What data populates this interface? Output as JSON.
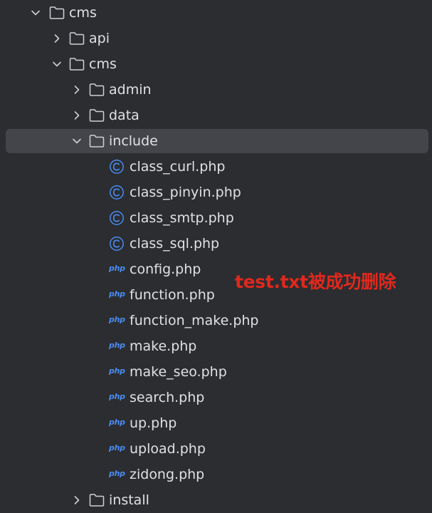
{
  "tree": {
    "items": [
      {
        "label": "cms",
        "icon": "folder-icon",
        "expanded": true
      },
      {
        "label": "api",
        "icon": "folder-icon",
        "expanded": false
      },
      {
        "label": "cms",
        "icon": "folder-icon",
        "expanded": true
      },
      {
        "label": "admin",
        "icon": "folder-icon",
        "expanded": false
      },
      {
        "label": "data",
        "icon": "folder-icon",
        "expanded": false
      },
      {
        "label": "include",
        "icon": "folder-icon",
        "expanded": true,
        "selected": true
      },
      {
        "label": "class_curl.php",
        "icon": "class-icon"
      },
      {
        "label": "class_pinyin.php",
        "icon": "class-icon"
      },
      {
        "label": "class_smtp.php",
        "icon": "class-icon"
      },
      {
        "label": "class_sql.php",
        "icon": "class-icon"
      },
      {
        "label": "config.php",
        "icon": "php-file-icon"
      },
      {
        "label": "function.php",
        "icon": "php-file-icon"
      },
      {
        "label": "function_make.php",
        "icon": "php-file-icon"
      },
      {
        "label": "make.php",
        "icon": "php-file-icon"
      },
      {
        "label": "make_seo.php",
        "icon": "php-file-icon"
      },
      {
        "label": "search.php",
        "icon": "php-file-icon"
      },
      {
        "label": "up.php",
        "icon": "php-file-icon"
      },
      {
        "label": "upload.php",
        "icon": "php-file-icon"
      },
      {
        "label": "zidong.php",
        "icon": "php-file-icon"
      },
      {
        "label": "install",
        "icon": "folder-icon",
        "expanded": false
      }
    ],
    "php_badge": "php"
  },
  "annotation": {
    "text": "test.txt被成功删除",
    "color": "#e0281e"
  },
  "colors": {
    "background": "#2b2d30",
    "selection": "#43454a",
    "text": "#dfe1e5",
    "class_icon": "#4b8bf0",
    "php_icon": "#4b8bf0"
  }
}
